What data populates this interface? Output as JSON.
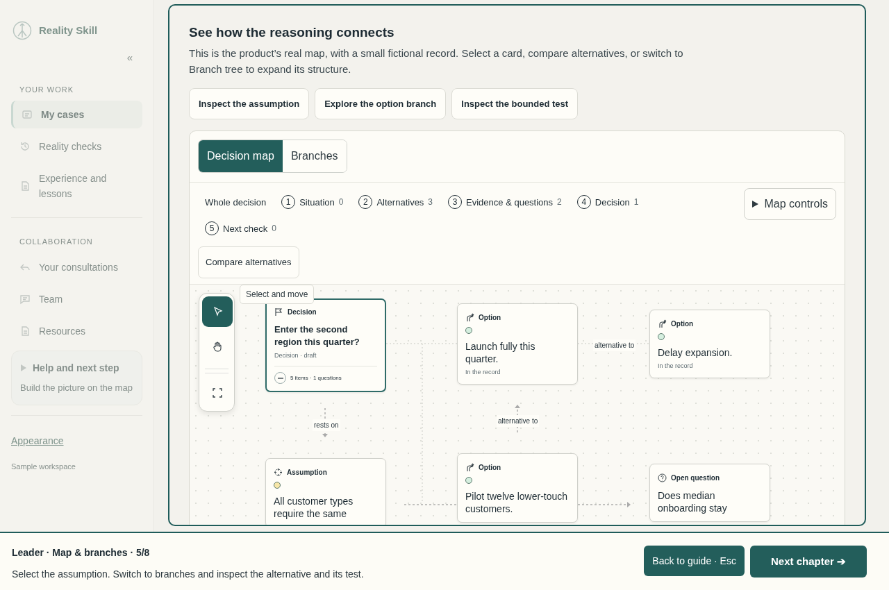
{
  "sidebar": {
    "brand": "Reality Skill",
    "collapse": "«",
    "sections": [
      {
        "heading": "YOUR WORK",
        "items": [
          {
            "label": "My cases",
            "selected": true
          },
          {
            "label": "Reality checks",
            "selected": false
          },
          {
            "label": "Experience and lessons",
            "selected": false
          }
        ]
      },
      {
        "heading": "COLLABORATION",
        "items": [
          {
            "label": "Your consultations",
            "selected": false
          },
          {
            "label": "Team",
            "selected": false
          },
          {
            "label": "Resources",
            "selected": false
          }
        ]
      }
    ],
    "help": {
      "title": "Help and next step",
      "text": "Build the picture on the map"
    },
    "appearance_link": "Appearance",
    "workspace_label": "Sample workspace"
  },
  "panel": {
    "title": "See how the reasoning connects",
    "description": "This is the product’s real map, with a small fictional record. Select a card, compare alternatives, or switch to Branch tree to expand its structure.",
    "actions": [
      "Inspect the assumption",
      "Explore the option branch",
      "Inspect the bounded test"
    ],
    "view_tabs": [
      {
        "label": "Decision map",
        "selected": true
      },
      {
        "label": "Branches",
        "selected": false
      }
    ],
    "filters": [
      {
        "label": "Whole decision"
      },
      {
        "number": "1",
        "label": "Situation",
        "count": "0"
      },
      {
        "number": "2",
        "label": "Alternatives",
        "count": "3"
      },
      {
        "number": "3",
        "label": "Evidence & questions",
        "count": "2"
      },
      {
        "number": "4",
        "label": "Decision",
        "count": "1"
      },
      {
        "number": "5",
        "label": "Next check",
        "count": "0"
      }
    ],
    "map_controls": "Map controls",
    "compare_button": "Compare alternatives",
    "tools": [
      {
        "kind": "select",
        "selected": true
      },
      {
        "kind": "pan",
        "selected": false
      },
      {
        "kind": "fit",
        "selected": false
      }
    ],
    "tooltip": "Select and move",
    "nodes": [
      {
        "kind": "decision",
        "type": "Decision",
        "title": "Enter the second region this quarter?",
        "meta": "Decision · draft",
        "footer": "5 items · 1 questions",
        "selected": true
      },
      {
        "kind": "option",
        "type": "Option",
        "color": "#d5efdf",
        "title": "Launch fully this quarter.",
        "meta": "In the record",
        "selected": false
      },
      {
        "kind": "option",
        "type": "Option",
        "color": "#d5efdf",
        "title": "Delay expansion.",
        "meta": "In the record",
        "selected": false
      },
      {
        "kind": "assumption",
        "type": "Assumption",
        "color": "#f7e6a8",
        "title": "All customer types require the same",
        "selected": false
      },
      {
        "kind": "option",
        "type": "Option",
        "color": "#d5efdf",
        "title": "Pilot twelve lower-touch customers.",
        "selected": false
      },
      {
        "kind": "question",
        "type": "Open question",
        "title": "Does median onboarding stay",
        "selected": false
      }
    ],
    "edge_labels": [
      "rests on",
      "alternative to",
      "alternative to"
    ]
  },
  "guide": {
    "heading": "Leader · Map & branches · 5/8",
    "instruction": "Select the assumption. Switch to branches and inspect the alternative and its test.",
    "buttons": [
      "Back to guide · Esc",
      "Next chapter ➔"
    ]
  }
}
